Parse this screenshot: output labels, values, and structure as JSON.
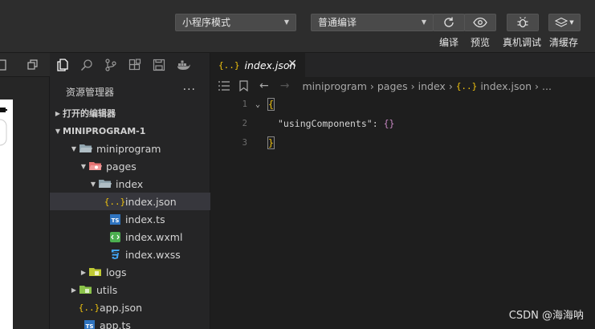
{
  "toolbar": {
    "mode_select": "小程序模式",
    "compile_select": "普通编译",
    "compile_label": "编译",
    "preview_label": "预览",
    "debug_label": "真机调试",
    "cache_label": "清缓存"
  },
  "explorer": {
    "title": "资源管理器",
    "more": "···",
    "open_editors": "打开的编辑器",
    "project": "MINIPROGRAM-1",
    "items": [
      {
        "label": "miniprogram"
      },
      {
        "label": "pages"
      },
      {
        "label": "index"
      },
      {
        "label": "index.json"
      },
      {
        "label": "index.ts"
      },
      {
        "label": "index.wxml"
      },
      {
        "label": "index.wxss"
      },
      {
        "label": "logs"
      },
      {
        "label": "utils"
      },
      {
        "label": "app.json"
      },
      {
        "label": "app.ts"
      }
    ]
  },
  "editor": {
    "tab_title": "index.json",
    "breadcrumb": [
      "miniprogram",
      "pages",
      "index",
      "index.json",
      "..."
    ],
    "lines": [
      {
        "num": "1",
        "text": "{"
      },
      {
        "num": "2",
        "key": "\"usingComponents\"",
        "punct": ": ",
        "value": "{}"
      },
      {
        "num": "3",
        "text": "}"
      }
    ]
  },
  "watermark": "CSDN @海海呐",
  "colors": {
    "accent": "#f1c40f",
    "active_row": "#37373d"
  }
}
